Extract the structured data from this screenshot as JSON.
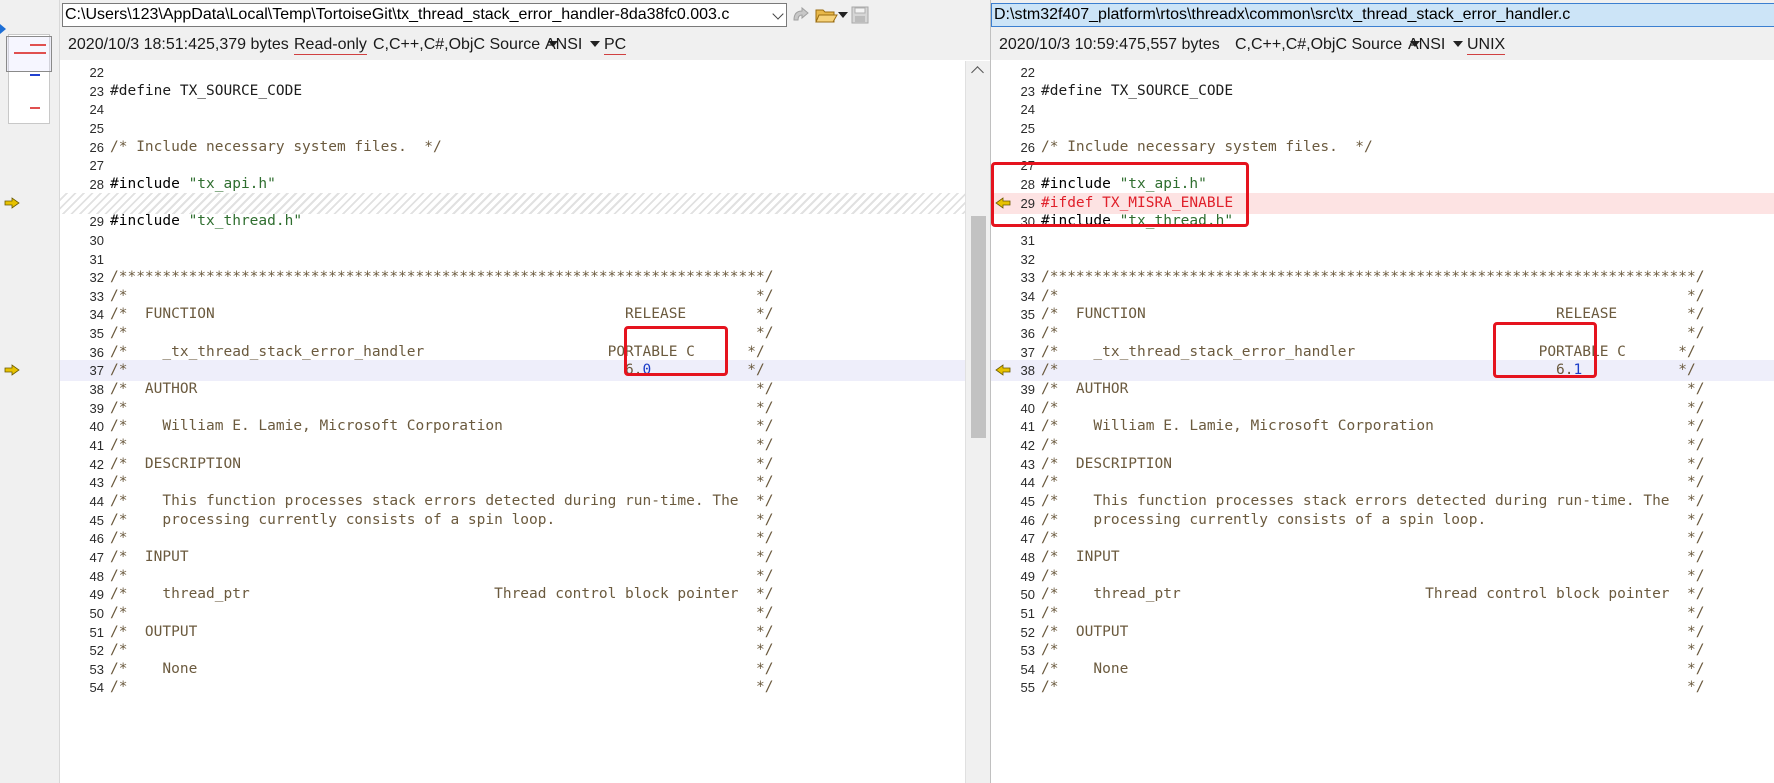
{
  "left": {
    "path": "C:\\Users\\123\\AppData\\Local\\Temp\\TortoiseGit\\tx_thread_stack_error_handler-8da38fc0.003.c",
    "date": "2020/10/3 18:51:42",
    "size": "5,379 bytes",
    "readonly": "Read-only",
    "lang": "C,C++,C#,ObjC Source",
    "encoding": "ANSI",
    "eol": "PC",
    "lines": [
      {
        "n": "22",
        "t": "",
        "k": ""
      },
      {
        "n": "23",
        "t": "#define TX_SOURCE_CODE",
        "k": "define"
      },
      {
        "n": "24",
        "t": "",
        "k": ""
      },
      {
        "n": "25",
        "t": "",
        "k": ""
      },
      {
        "n": "26",
        "t": "/* Include necessary system files.  */",
        "k": "cm"
      },
      {
        "n": "27",
        "t": "",
        "k": ""
      },
      {
        "n": "28",
        "a": "#include ",
        "b": "\"tx_api.h\"",
        "k": "inc"
      },
      {
        "n": "",
        "t": "",
        "k": "hatch"
      },
      {
        "n": "29",
        "a": "#include ",
        "b": "\"tx_thread.h\"",
        "k": "inc"
      },
      {
        "n": "30",
        "t": "",
        "k": ""
      },
      {
        "n": "31",
        "t": "",
        "k": ""
      },
      {
        "n": "32",
        "t": "/**************************************************************************/",
        "k": "cm"
      },
      {
        "n": "33",
        "t": "/*                                                                        */",
        "k": "cm"
      },
      {
        "n": "34",
        "t": "/*  FUNCTION                                               RELEASE        */",
        "k": "cm"
      },
      {
        "n": "35",
        "t": "/*                                                                        */",
        "k": "cm"
      },
      {
        "n": "36",
        "t": "/*    _tx_thread_stack_error_handler                     PORTABLE C      */",
        "k": "cm"
      },
      {
        "n": "37",
        "a": "/*                                                         6.",
        "b": "0",
        "c": "           */",
        "k": "ver"
      },
      {
        "n": "38",
        "t": "/*  AUTHOR                                                                */",
        "k": "cm"
      },
      {
        "n": "39",
        "t": "/*                                                                        */",
        "k": "cm"
      },
      {
        "n": "40",
        "t": "/*    William E. Lamie, Microsoft Corporation                             */",
        "k": "cm"
      },
      {
        "n": "41",
        "t": "/*                                                                        */",
        "k": "cm"
      },
      {
        "n": "42",
        "t": "/*  DESCRIPTION                                                           */",
        "k": "cm"
      },
      {
        "n": "43",
        "t": "/*                                                                        */",
        "k": "cm"
      },
      {
        "n": "44",
        "t": "/*    This function processes stack errors detected during run-time. The  */",
        "k": "cm"
      },
      {
        "n": "45",
        "t": "/*    processing currently consists of a spin loop.                       */",
        "k": "cm"
      },
      {
        "n": "46",
        "t": "/*                                                                        */",
        "k": "cm"
      },
      {
        "n": "47",
        "t": "/*  INPUT                                                                 */",
        "k": "cm"
      },
      {
        "n": "48",
        "t": "/*                                                                        */",
        "k": "cm"
      },
      {
        "n": "49",
        "t": "/*    thread_ptr                            Thread control block pointer  */",
        "k": "cm"
      },
      {
        "n": "50",
        "t": "/*                                                                        */",
        "k": "cm"
      },
      {
        "n": "51",
        "t": "/*  OUTPUT                                                                */",
        "k": "cm"
      },
      {
        "n": "52",
        "t": "/*                                                                        */",
        "k": "cm"
      },
      {
        "n": "53",
        "t": "/*    None                                                                */",
        "k": "cm"
      },
      {
        "n": "54",
        "t": "/*                                                                        */",
        "k": "cm"
      }
    ]
  },
  "right": {
    "path": "D:\\stm32f407_platform\\rtos\\threadx\\common\\src\\tx_thread_stack_error_handler.c",
    "date": "2020/10/3 10:59:47",
    "size": "5,557 bytes",
    "lang": "C,C++,C#,ObjC Source",
    "encoding": "ANSI",
    "eol": "UNIX",
    "lines": [
      {
        "n": "22",
        "t": "",
        "k": ""
      },
      {
        "n": "23",
        "t": "#define TX_SOURCE_CODE",
        "k": "define"
      },
      {
        "n": "24",
        "t": "",
        "k": ""
      },
      {
        "n": "25",
        "t": "",
        "k": ""
      },
      {
        "n": "26",
        "t": "/* Include necessary system files.  */",
        "k": "cm"
      },
      {
        "n": "27",
        "t": "",
        "k": ""
      },
      {
        "n": "28",
        "a": "#include ",
        "b": "\"tx_api.h\"",
        "k": "inc"
      },
      {
        "n": "29",
        "t": "#ifdef TX_MISRA_ENABLE",
        "k": "add"
      },
      {
        "n": "30",
        "a": "#include ",
        "b": "\"tx_thread.h\"",
        "k": "inc"
      },
      {
        "n": "31",
        "t": "",
        "k": ""
      },
      {
        "n": "32",
        "t": "",
        "k": ""
      },
      {
        "n": "33",
        "t": "/**************************************************************************/",
        "k": "cm"
      },
      {
        "n": "34",
        "t": "/*                                                                        */",
        "k": "cm"
      },
      {
        "n": "35",
        "t": "/*  FUNCTION                                               RELEASE        */",
        "k": "cm"
      },
      {
        "n": "36",
        "t": "/*                                                                        */",
        "k": "cm"
      },
      {
        "n": "37",
        "t": "/*    _tx_thread_stack_error_handler                     PORTABLE C      */",
        "k": "cm"
      },
      {
        "n": "38",
        "a": "/*                                                         6.",
        "b": "1",
        "c": "           */",
        "k": "ver"
      },
      {
        "n": "39",
        "t": "/*  AUTHOR                                                                */",
        "k": "cm"
      },
      {
        "n": "40",
        "t": "/*                                                                        */",
        "k": "cm"
      },
      {
        "n": "41",
        "t": "/*    William E. Lamie, Microsoft Corporation                             */",
        "k": "cm"
      },
      {
        "n": "42",
        "t": "/*                                                                        */",
        "k": "cm"
      },
      {
        "n": "43",
        "t": "/*  DESCRIPTION                                                           */",
        "k": "cm"
      },
      {
        "n": "44",
        "t": "/*                                                                        */",
        "k": "cm"
      },
      {
        "n": "45",
        "t": "/*    This function processes stack errors detected during run-time. The  */",
        "k": "cm"
      },
      {
        "n": "46",
        "t": "/*    processing currently consists of a spin loop.                       */",
        "k": "cm"
      },
      {
        "n": "47",
        "t": "/*                                                                        */",
        "k": "cm"
      },
      {
        "n": "48",
        "t": "/*  INPUT                                                                 */",
        "k": "cm"
      },
      {
        "n": "49",
        "t": "/*                                                                        */",
        "k": "cm"
      },
      {
        "n": "50",
        "t": "/*    thread_ptr                            Thread control block pointer  */",
        "k": "cm"
      },
      {
        "n": "51",
        "t": "/*                                                                        */",
        "k": "cm"
      },
      {
        "n": "52",
        "t": "/*  OUTPUT                                                                */",
        "k": "cm"
      },
      {
        "n": "53",
        "t": "/*                                                                        */",
        "k": "cm"
      },
      {
        "n": "54",
        "t": "/*    None                                                                */",
        "k": "cm"
      },
      {
        "n": "55",
        "t": "/*                                                                        */",
        "k": "cm"
      }
    ]
  },
  "icons": {
    "location_pane": "diff-location-icon",
    "merge": "merge-arrow-icon",
    "open": "open-folder-icon",
    "save": "save-disk-icon",
    "diff_marker_left": "diff-arrow-right-icon",
    "diff_marker_right": "diff-arrow-left-icon"
  },
  "colors": {
    "highlight_box": "#e5131e",
    "added_line": "#fde3e3",
    "current_line": "#eeeefa",
    "marker": "#e7c200"
  }
}
